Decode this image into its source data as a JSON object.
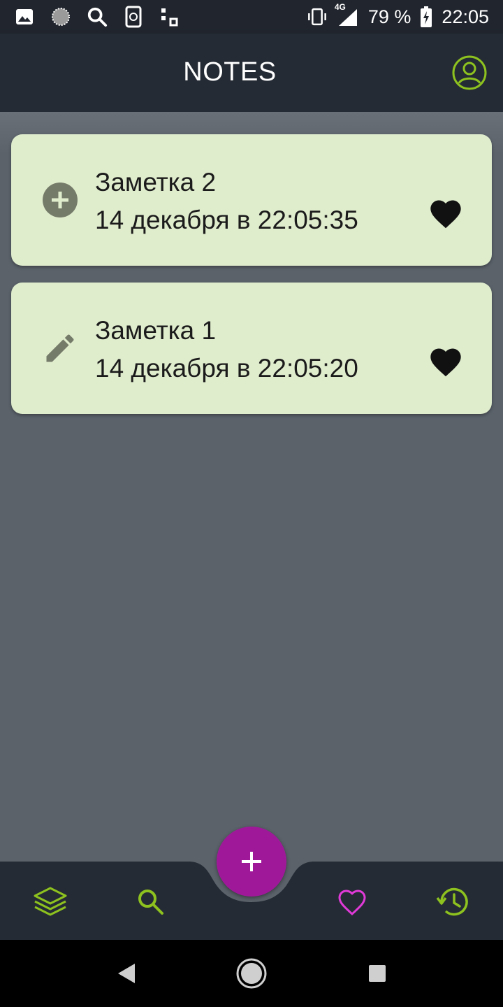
{
  "status_bar": {
    "battery": "79 %",
    "time": "22:05",
    "network": "4G",
    "icons": [
      "image-icon",
      "loading-icon",
      "search-icon",
      "sync-icon",
      "qr-icon",
      "vibrate-icon",
      "signal-icon",
      "battery-charging-icon"
    ]
  },
  "app_bar": {
    "title": "NOTES",
    "profile_icon": "account-circle-icon"
  },
  "notes": [
    {
      "title": "Заметка 2",
      "date": "14 декабря в 22:05:35",
      "type_icon": "add-circle-icon",
      "favorite": true
    },
    {
      "title": "Заметка 1",
      "date": "14 декабря в 22:05:20",
      "type_icon": "edit-pencil-icon",
      "favorite": true
    }
  ],
  "bottom_nav": {
    "items": [
      "layers-icon",
      "search-icon",
      "heart-outline-icon",
      "history-icon"
    ],
    "fab_icon": "plus-icon"
  },
  "colors": {
    "background": "#5b626a",
    "bar": "#252b34",
    "card": "#e0edcd",
    "accent_green": "#8dc21f",
    "accent_magenta": "#e03ad8",
    "fab": "#a0189a"
  }
}
